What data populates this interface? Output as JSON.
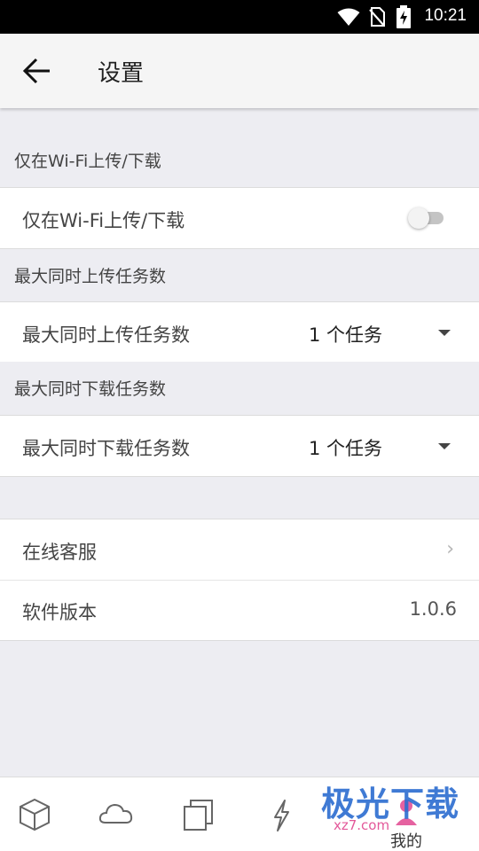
{
  "status_bar": {
    "time": "10:21"
  },
  "header": {
    "title": "设置"
  },
  "sections": {
    "wifi": {
      "header": "仅在Wi-Fi上传/下载",
      "label": "仅在Wi-Fi上传/下载",
      "toggle_on": false
    },
    "upload": {
      "header": "最大同时上传任务数",
      "label": "最大同时上传任务数",
      "value": "1 个任务"
    },
    "download": {
      "header": "最大同时下载任务数",
      "label": "最大同时下载任务数",
      "value": "1 个任务"
    }
  },
  "support": {
    "label": "在线客服"
  },
  "version": {
    "label": "软件版本",
    "value": "1.0.6"
  },
  "bottom_nav": {
    "items": [
      {
        "icon": "cube-icon"
      },
      {
        "icon": "cloud-icon"
      },
      {
        "icon": "copy-icon"
      },
      {
        "icon": "lightning-icon"
      },
      {
        "icon": "person-icon",
        "label": "我的"
      }
    ]
  },
  "watermark": {
    "text": "极光下载",
    "site": "xz7.com"
  }
}
